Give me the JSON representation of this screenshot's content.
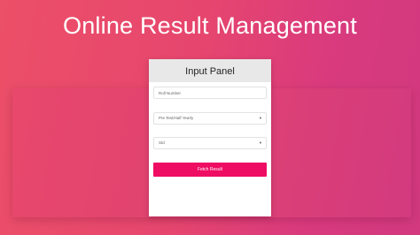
{
  "app": {
    "title": "Online Result Management"
  },
  "panel": {
    "title": "Input Panel",
    "roll_placeholder": "Roll Number",
    "exam_select": {
      "selected": "Pre Test/Half Yearly"
    },
    "standard_select": {
      "selected": "Std"
    },
    "fetch_label": "Fetch Result"
  },
  "colors": {
    "background_start": "#ec4f68",
    "background_end": "#d2397f",
    "button": "#ef0c63",
    "panel_header": "#e8e8e8"
  },
  "icons": {
    "select_caret": "dropdown-caret-icon"
  }
}
